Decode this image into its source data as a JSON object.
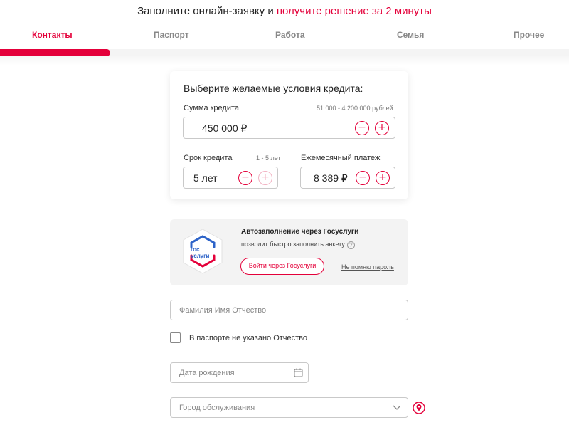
{
  "header": {
    "prefix": "Заполните онлайн-заявку и",
    "accent": "получите решение за 2 минуты"
  },
  "steps": [
    {
      "label": "Контакты",
      "active": true
    },
    {
      "label": "Паспорт",
      "active": false
    },
    {
      "label": "Работа",
      "active": false
    },
    {
      "label": "Семья",
      "active": false
    },
    {
      "label": "Прочее",
      "active": false
    }
  ],
  "progress": {
    "step": 1,
    "total": 5,
    "fill_percent": 19.4
  },
  "calculator": {
    "title": "Выберите желаемые условия кредита:",
    "amount": {
      "label": "Сумма кредита",
      "range": "51 000 - 4 200 000 рублей",
      "value": "450 000 ₽"
    },
    "term": {
      "label": "Срок кредита",
      "range": "1 - 5 лет",
      "value": "5 лет"
    },
    "payment": {
      "label": "Ежемесячный платеж",
      "value": "8 389 ₽"
    },
    "minus": "−",
    "plus": "+"
  },
  "gosuslugi": {
    "logo_line1": "гос",
    "logo_line2": "услуги",
    "title": "Автозаполнение через Госуслуги",
    "subtitle": "позволит быстро заполнить анкету",
    "help": "?",
    "button": "Войти через Госуслуги",
    "forgot": "Не помню пароль"
  },
  "form": {
    "fio_placeholder": "Фамилия Имя Отчество",
    "no_patronymic_label": "В паспорте не указано Отчество",
    "birthdate_placeholder": "Дата рождения",
    "city_placeholder": "Город обслуживания"
  },
  "icons": {
    "calendar": "calendar-icon",
    "chevron": "chevron-down-icon",
    "location": "location-pin-icon"
  },
  "colors": {
    "accent": "#e4003a",
    "gos_blue": "#2d63c8"
  }
}
